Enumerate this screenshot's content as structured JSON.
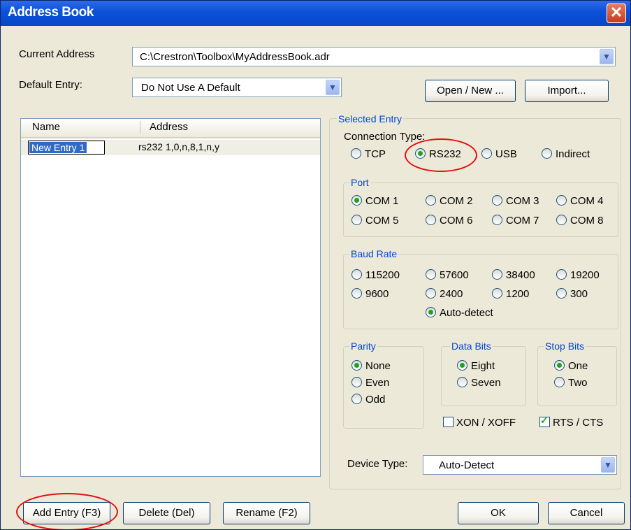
{
  "window": {
    "title": "Address Book",
    "close_glyph": "✕"
  },
  "current_address": {
    "label": "Current Address",
    "value": "C:\\Crestron\\Toolbox\\MyAddressBook.adr"
  },
  "default_entry": {
    "label": "Default Entry:",
    "value": "Do Not Use A Default"
  },
  "top_buttons": {
    "open_new": "Open / New ...",
    "import": "Import..."
  },
  "list": {
    "columns": [
      "Name",
      "Address"
    ],
    "rows": [
      {
        "name": "New Entry 1",
        "address": "rs232 1,0,n,8,1,n,y"
      }
    ]
  },
  "selected_entry": {
    "title": "Selected Entry",
    "connection_type": {
      "label": "Connection Type:",
      "options": [
        "TCP",
        "RS232",
        "USB",
        "Indirect"
      ],
      "selected": "RS232"
    },
    "port": {
      "title": "Port",
      "options": [
        "COM 1",
        "COM 2",
        "COM 3",
        "COM 4",
        "COM 5",
        "COM 6",
        "COM 7",
        "COM 8"
      ],
      "selected": "COM 1"
    },
    "baud_rate": {
      "title": "Baud Rate",
      "options": [
        "115200",
        "57600",
        "38400",
        "19200",
        "9600",
        "2400",
        "1200",
        "300",
        "Auto-detect"
      ],
      "selected": "Auto-detect"
    },
    "parity": {
      "title": "Parity",
      "options": [
        "None",
        "Even",
        "Odd"
      ],
      "selected": "None"
    },
    "data_bits": {
      "title": "Data Bits",
      "options": [
        "Eight",
        "Seven"
      ],
      "selected": "Eight"
    },
    "stop_bits": {
      "title": "Stop Bits",
      "options": [
        "One",
        "Two"
      ],
      "selected": "One"
    },
    "flow_control": {
      "xon_xoff": {
        "label": "XON / XOFF",
        "checked": false
      },
      "rts_cts": {
        "label": "RTS / CTS",
        "checked": true
      }
    },
    "device_type": {
      "label": "Device Type:",
      "value": "Auto-Detect"
    }
  },
  "bottom_buttons": {
    "add": "Add Entry (F3)",
    "delete": "Delete (Del)",
    "rename": "Rename (F2)",
    "ok": "OK",
    "cancel": "Cancel"
  },
  "annotations": {
    "highlight_color": "#e01010"
  }
}
